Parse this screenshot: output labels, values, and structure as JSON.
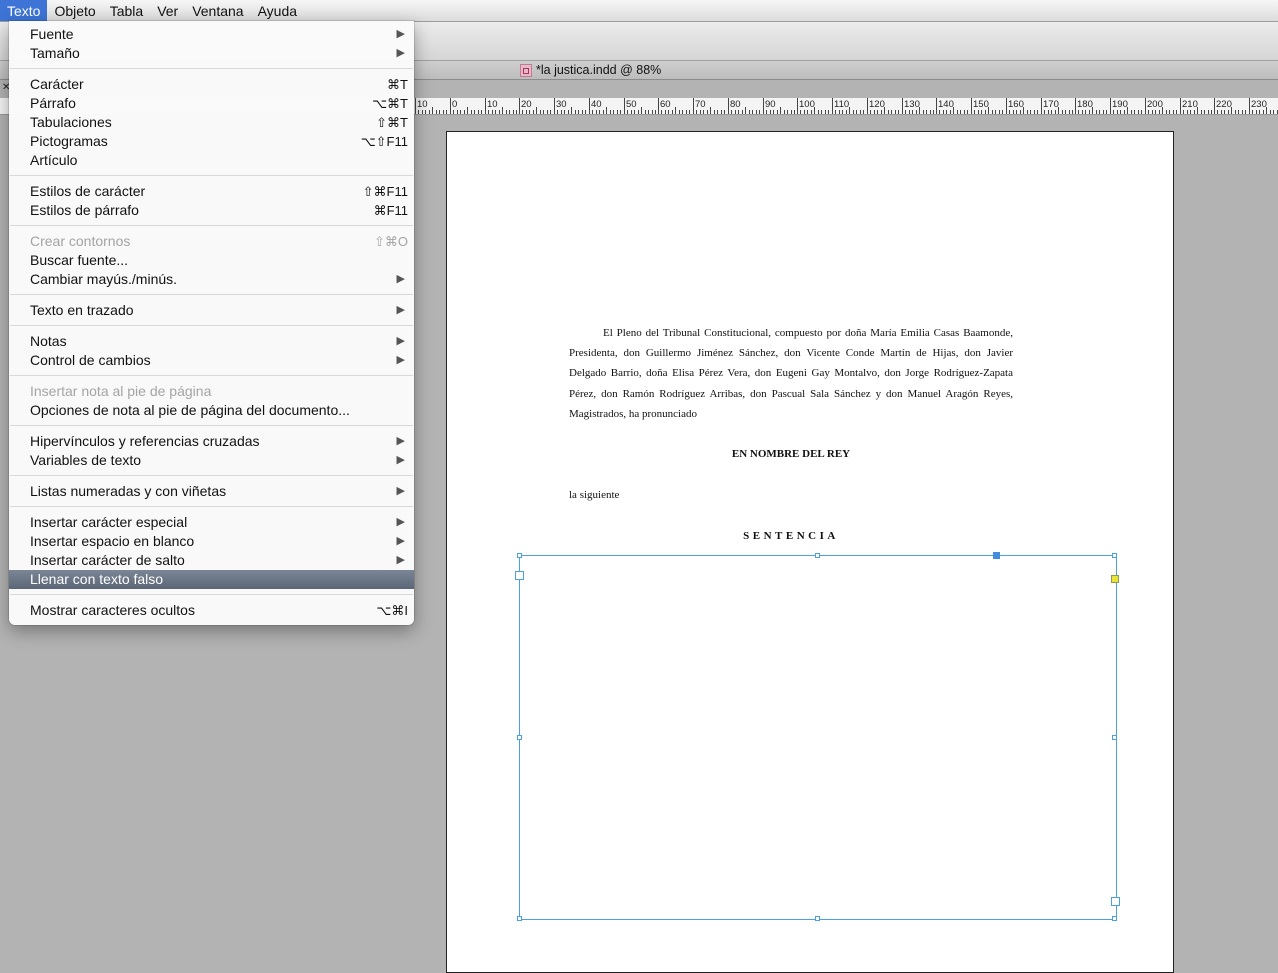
{
  "menubar": {
    "items": [
      {
        "label": "Texto",
        "active": true
      },
      {
        "label": "Objeto"
      },
      {
        "label": "Tabla"
      },
      {
        "label": "Ver"
      },
      {
        "label": "Ventana"
      },
      {
        "label": "Ayuda"
      }
    ]
  },
  "document_tab": {
    "title": "*la justica.indd @ 88%"
  },
  "ruler": {
    "labels": [
      "10",
      "0",
      "10",
      "20",
      "30",
      "40",
      "50",
      "60",
      "70",
      "80",
      "90",
      "100",
      "110",
      "120",
      "130",
      "140",
      "150",
      "160",
      "170",
      "180",
      "190",
      "200",
      "210",
      "220",
      "230"
    ]
  },
  "menu": {
    "groups": [
      [
        {
          "label": "Fuente",
          "submenu": true
        },
        {
          "label": "Tamaño",
          "submenu": true
        }
      ],
      [
        {
          "label": "Carácter",
          "shortcut": "⌘T"
        },
        {
          "label": "Párrafo",
          "shortcut": "⌥⌘T"
        },
        {
          "label": "Tabulaciones",
          "shortcut": "⇧⌘T"
        },
        {
          "label": "Pictogramas",
          "shortcut": "⌥⇧F11"
        },
        {
          "label": "Artículo"
        }
      ],
      [
        {
          "label": "Estilos de carácter",
          "shortcut": "⇧⌘F11"
        },
        {
          "label": "Estilos de párrafo",
          "shortcut": "⌘F11"
        }
      ],
      [
        {
          "label": "Crear contornos",
          "shortcut": "⇧⌘O",
          "disabled": true
        },
        {
          "label": "Buscar fuente..."
        },
        {
          "label": "Cambiar mayús./minús.",
          "submenu": true
        }
      ],
      [
        {
          "label": "Texto en trazado",
          "submenu": true
        }
      ],
      [
        {
          "label": "Notas",
          "submenu": true
        },
        {
          "label": "Control de cambios",
          "submenu": true
        }
      ],
      [
        {
          "label": "Insertar nota al pie de página",
          "disabled": true
        },
        {
          "label": "Opciones de nota al pie de página del documento..."
        }
      ],
      [
        {
          "label": "Hipervínculos y referencias cruzadas",
          "submenu": true
        },
        {
          "label": "Variables de texto",
          "submenu": true
        }
      ],
      [
        {
          "label": "Listas numeradas y con viñetas",
          "submenu": true
        }
      ],
      [
        {
          "label": "Insertar carácter especial",
          "submenu": true
        },
        {
          "label": "Insertar espacio en blanco",
          "submenu": true
        },
        {
          "label": "Insertar carácter de salto",
          "submenu": true
        },
        {
          "label": "Llenar con texto falso",
          "highlighted": true
        }
      ],
      [
        {
          "label": "Mostrar caracteres ocultos",
          "shortcut": "⌥⌘I"
        }
      ]
    ]
  },
  "page": {
    "paragraph": "El Pleno del Tribunal Constitucional, compuesto por doña María Emilia Casas Baamonde, Presidenta, don Guillermo Jiménez Sánchez, don Vicente Conde Martín de Hijas, don Javier Delgado Barrio, doña Elisa Pérez Vera, don Eugeni Gay Montalvo, don Jorge Rodríguez-Zapata Pérez, don Ramón Rodríguez Arribas, don Pascual Sala Sánchez y don Manuel Aragón Reyes, Magistrados, ha pronunciado",
    "heading1": "EN NOMBRE DEL REY",
    "plain": "la siguiente",
    "heading2": "SENTENCIA"
  }
}
